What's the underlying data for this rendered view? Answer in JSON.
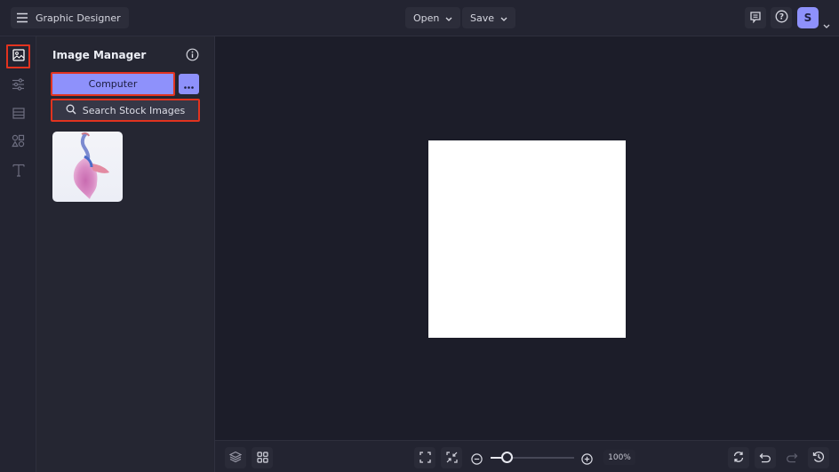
{
  "header": {
    "app_title": "Graphic Designer",
    "open_label": "Open",
    "save_label": "Save",
    "avatar_initial": "S"
  },
  "rail": {
    "items": [
      {
        "name": "image-manager",
        "icon": "image-icon",
        "active": true
      },
      {
        "name": "adjustments",
        "icon": "sliders-icon",
        "active": false
      },
      {
        "name": "layout",
        "icon": "layout-icon",
        "active": false
      },
      {
        "name": "graphics",
        "icon": "shapes-icon",
        "active": false
      },
      {
        "name": "text",
        "icon": "text-icon",
        "active": false
      }
    ]
  },
  "panel": {
    "title": "Image Manager",
    "computer_label": "Computer",
    "more_label": "···",
    "stock_label": "Search Stock Images",
    "thumbnails": [
      {
        "subject": "betta fish"
      }
    ]
  },
  "bottombar": {
    "zoom_value": "100%",
    "zoom_level_fraction": 0.2
  },
  "colors": {
    "accent": "#8e91fb",
    "highlight_border": "#e2331f",
    "background": "#1c1d29",
    "panel": "#252632"
  }
}
